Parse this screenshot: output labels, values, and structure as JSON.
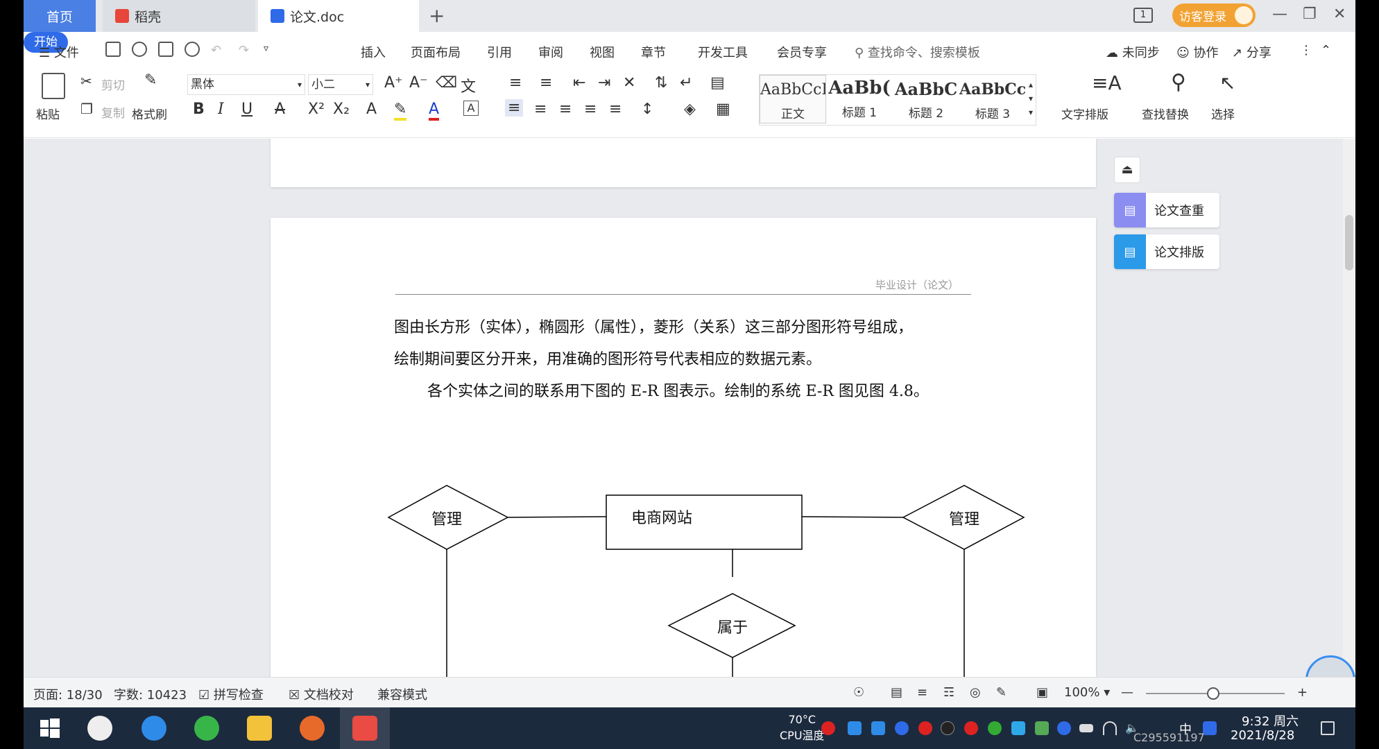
{
  "tabs": {
    "home": "首页",
    "daoke": "稻壳",
    "doc": "论文.doc",
    "add": "+"
  },
  "title_bar": {
    "page_indicator": "1",
    "guest_login": "访客登录"
  },
  "menu": {
    "file": "文件",
    "items": [
      "开始",
      "插入",
      "页面布局",
      "引用",
      "审阅",
      "视图",
      "章节",
      "开发工具",
      "会员专享"
    ],
    "search_placeholder": "查找命令、搜索模板",
    "sync": "未同步",
    "collab": "协作",
    "share": "分享"
  },
  "ribbon": {
    "paste": "粘贴",
    "cut": "剪切",
    "copy": "复制",
    "format_painter": "格式刷",
    "font_name": "黑体",
    "font_size": "小二",
    "styles": [
      {
        "preview": "AaBbCcI",
        "name": "正文"
      },
      {
        "preview": "AaBb(",
        "name": "标题 1"
      },
      {
        "preview": "AaBbC",
        "name": "标题 2"
      },
      {
        "preview": "AaBbCcl",
        "name": "标题 3"
      }
    ],
    "text_layout": "文字排版",
    "find_replace": "查找替换",
    "select": "选择"
  },
  "document": {
    "header": "毕业设计（论文）",
    "para1": "图由长方形（实体），椭圆形（属性），菱形（关系）这三部分图形符号组成，",
    "para2": "绘制期间要区分开来，用准确的图形符号代表相应的数据元素。",
    "para3": "各个实体之间的联系用下图的 E-R 图表示。绘制的系统 E-R 图见图 4.8。",
    "er_diagram": {
      "entity": "电商网站",
      "left_relation": "管理",
      "right_relation": "管理",
      "bottom_relation": "属于"
    }
  },
  "side_panel": {
    "check": "论文查重",
    "format": "论文排版"
  },
  "status": {
    "page": "页面: 18/30",
    "words": "字数: 10423",
    "spell": "拼写检查",
    "proof": "文档校对",
    "compat": "兼容模式",
    "zoom": "100%"
  },
  "taskbar": {
    "cpu_temp": "70°C",
    "cpu_label": "CPU温度",
    "input_lang": "中",
    "time": "9:32 周六",
    "date": "2021/8/28",
    "watermark": "C295591197"
  },
  "colors": {
    "accent": "#2f6be8",
    "home_tab": "#4a7fe3",
    "guest": "#f2a233"
  }
}
